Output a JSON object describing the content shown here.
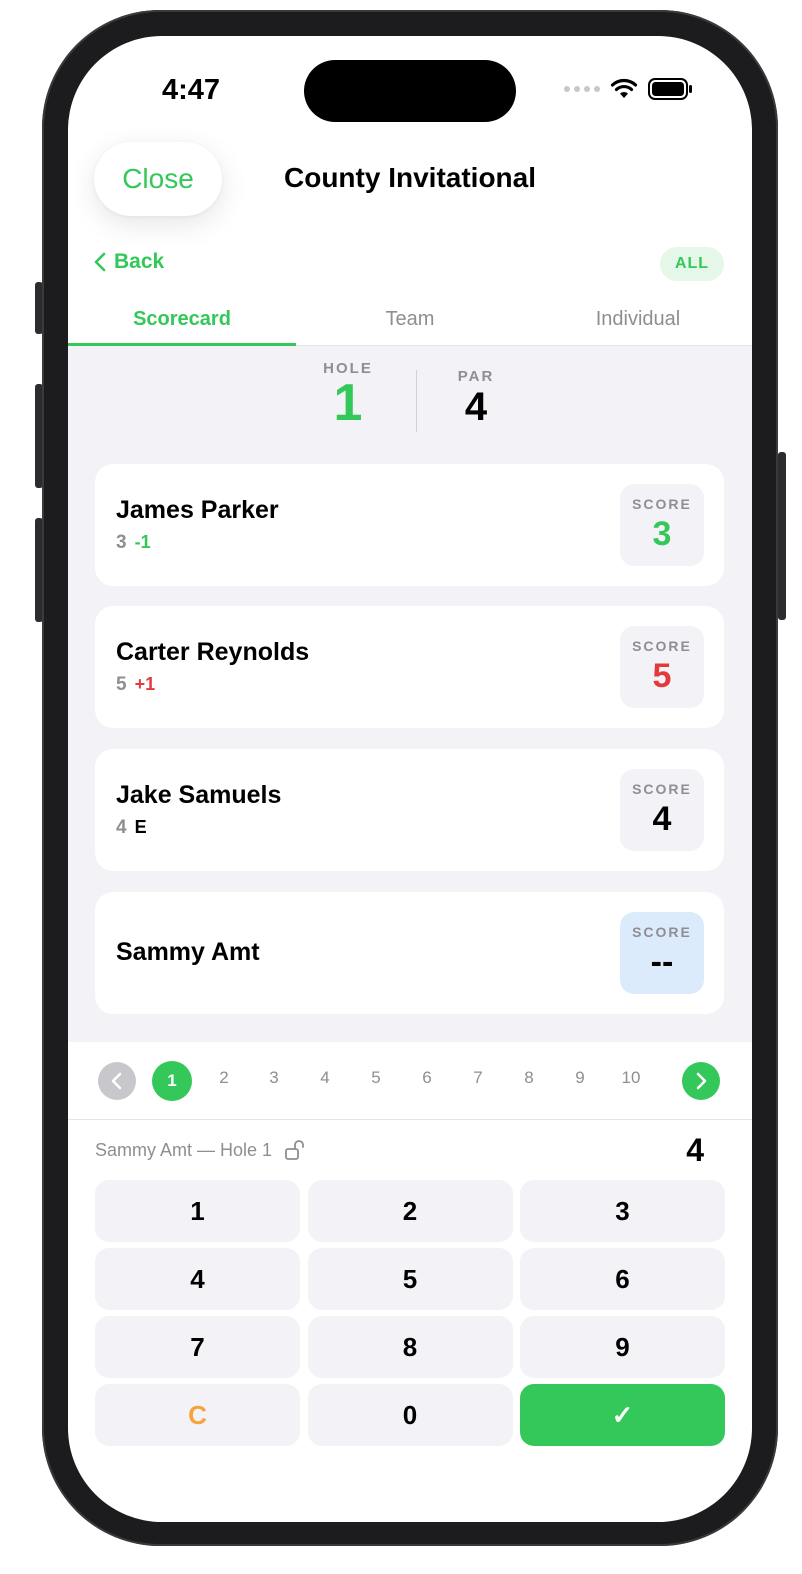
{
  "status_bar": {
    "time": "4:47"
  },
  "header": {
    "close_label": "Close",
    "title": "County Invitational"
  },
  "nav": {
    "back_label": "Back",
    "filter_badge": "ALL"
  },
  "tabs": [
    {
      "label": "Scorecard",
      "active": true
    },
    {
      "label": "Team",
      "active": false
    },
    {
      "label": "Individual",
      "active": false
    }
  ],
  "hole_info": {
    "hole_label": "HOLE",
    "hole_value": "1",
    "par_label": "PAR",
    "par_value": "4"
  },
  "players": [
    {
      "name": "James Parker",
      "strokes": "3",
      "relative": "-1",
      "relative_color": "#34c759",
      "score_label": "SCORE",
      "score": "3",
      "score_color": "#34c759"
    },
    {
      "name": "Carter Reynolds",
      "strokes": "5",
      "relative": "+1",
      "relative_color": "#e5383b",
      "score_label": "SCORE",
      "score": "5",
      "score_color": "#e5383b"
    },
    {
      "name": "Jake Samuels",
      "strokes": "4",
      "relative": "E",
      "relative_color": "#000000",
      "score_label": "SCORE",
      "score": "4",
      "score_color": "#000000"
    },
    {
      "name": "Sammy Amt",
      "strokes": "",
      "relative": "",
      "relative_color": "#000000",
      "score_label": "SCORE",
      "score": "--",
      "score_color": "#000000",
      "active": true
    }
  ],
  "hole_selector": {
    "holes": [
      "1",
      "2",
      "3",
      "4",
      "5",
      "6",
      "7",
      "8",
      "9",
      "10"
    ],
    "active": "1",
    "prev_icon": "chevron-left-icon",
    "next_icon": "chevron-right-icon"
  },
  "entry": {
    "label": "Sammy Amt — Hole 1",
    "lock_icon": "unlock-icon",
    "value": "4"
  },
  "keypad": {
    "keys": [
      "1",
      "2",
      "3",
      "4",
      "5",
      "6",
      "7",
      "8",
      "9",
      "C",
      "0",
      "✓"
    ]
  },
  "colors": {
    "accent": "#34c759",
    "over_par": "#e5383b",
    "clear": "#f7a23b",
    "active_score_bg": "#dcebfc"
  }
}
